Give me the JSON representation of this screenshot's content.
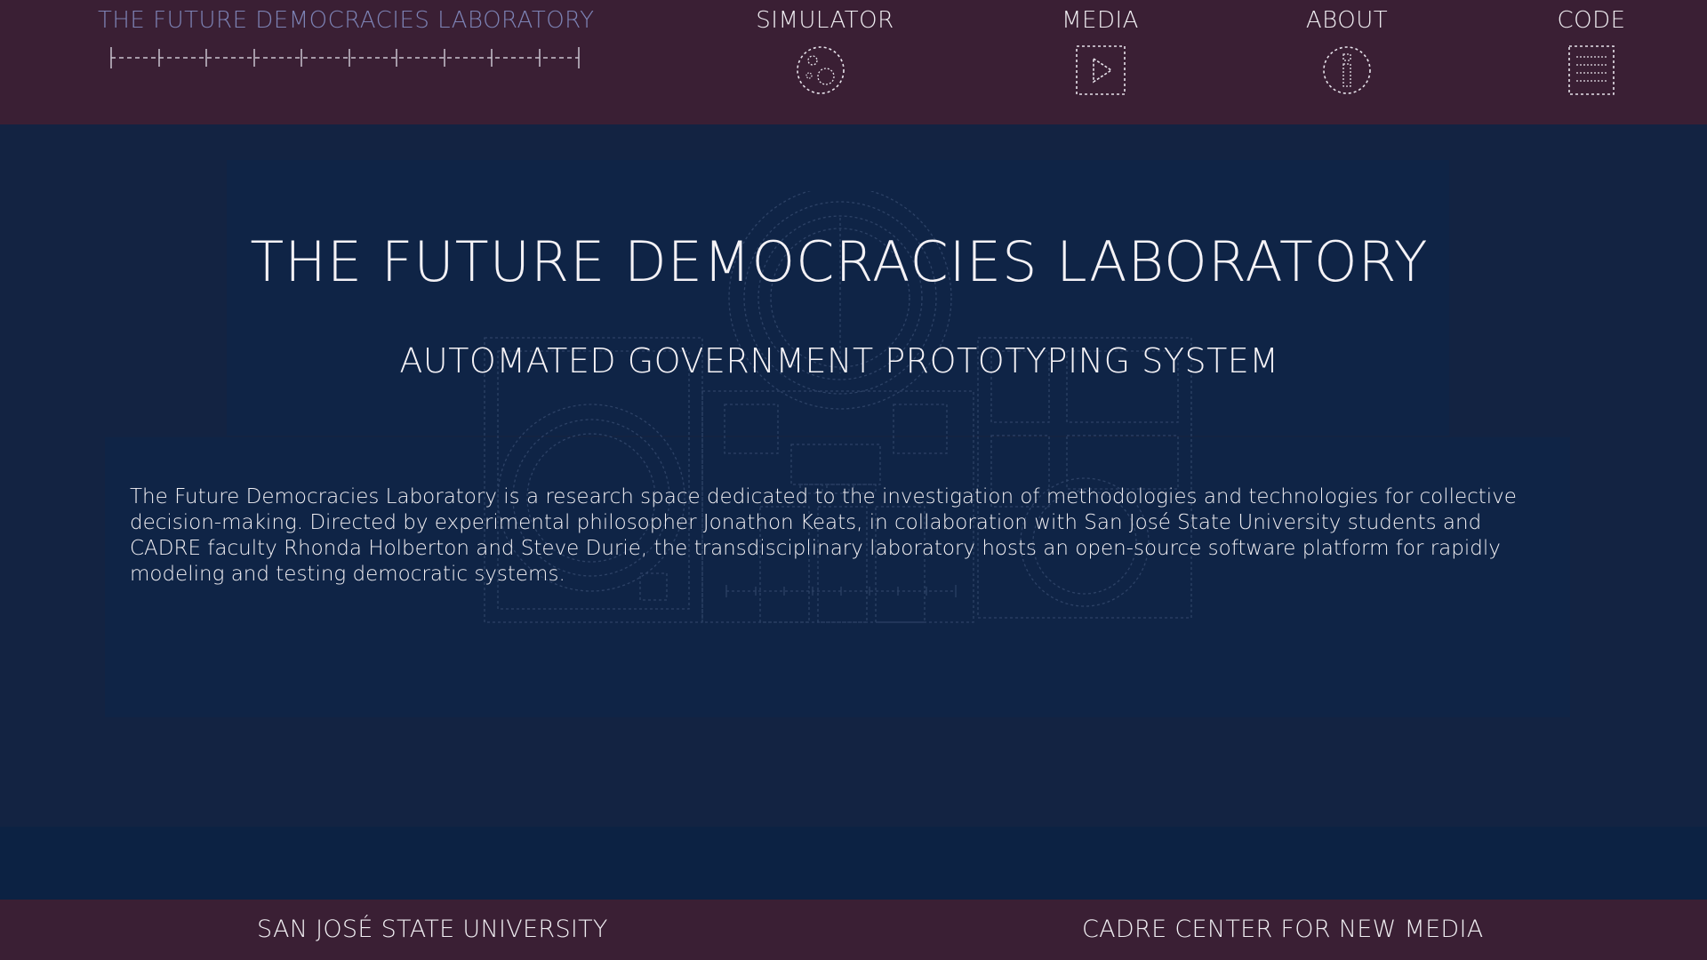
{
  "header": {
    "home": {
      "label": "THE FUTURE DEMOCRACIES LABORATORY",
      "icon": "dashed-ruler-icon"
    },
    "nav": [
      {
        "label": "SIMULATOR",
        "icon": "dotted-circle-simulator-icon"
      },
      {
        "label": "MEDIA",
        "icon": "play-icon"
      },
      {
        "label": "ABOUT",
        "icon": "info-icon"
      },
      {
        "label": "CODE",
        "icon": "document-lines-icon"
      }
    ]
  },
  "hero": {
    "title": "THE FUTURE DEMOCRACIES LABORATORY",
    "subtitle": "AUTOMATED GOVERNMENT PROTOTYPING SYSTEM"
  },
  "description": "The Future Democracies Laboratory is a research space dedicated to the investigation of methodologies and technologies for collective decision-making. Directed by experimental philosopher Jonathon Keats, in collaboration with San José State University students and CADRE faculty Rhonda Holberton and Steve Durie, the transdisciplinary laboratory hosts an open-source software platform for rapidly modeling and testing democratic systems.",
  "footer": {
    "left": "SAN JOSÉ STATE UNIVERSITY",
    "right": "CADRE CENTER FOR NEW MEDIA"
  },
  "colors": {
    "bar_background": "#3a1f34",
    "main_background": "#132342",
    "panel_background": "#0f2446",
    "home_link": "#7d83b5",
    "text": "#f2f0f4"
  }
}
